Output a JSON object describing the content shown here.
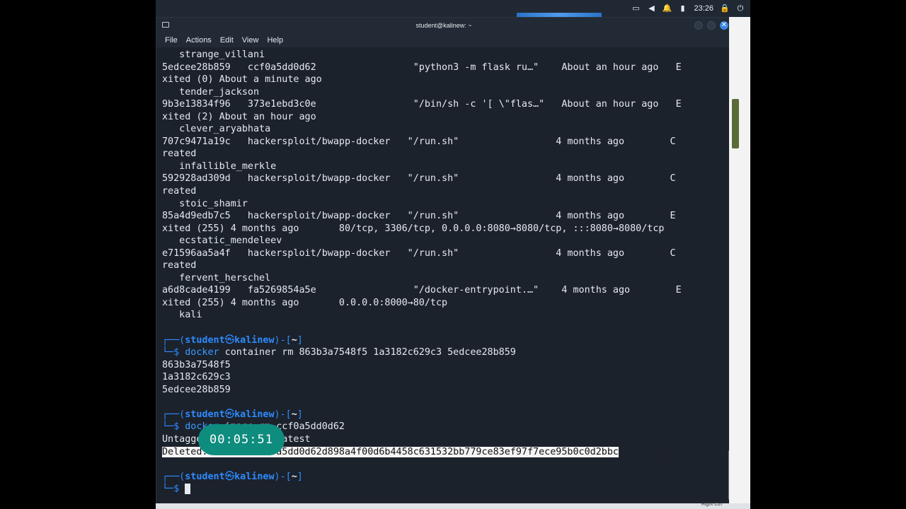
{
  "topbar": {
    "clock": "23:26",
    "icons": [
      "window-icon",
      "volume-icon",
      "bell-icon",
      "battery-icon",
      "lock-icon",
      "power-icon"
    ]
  },
  "window": {
    "title": "student@kalinew: ~",
    "menu": [
      "File",
      "Actions",
      "Edit",
      "View",
      "Help"
    ]
  },
  "terminal": {
    "output_lines": [
      "   strange_villani",
      "5edcee28b859   ccf0a5dd0d62                 \"python3 -m flask ru…\"    About an hour ago   E",
      "xited (0) About a minute ago",
      "   tender_jackson",
      "9b3e13834f96   373e1ebd3c0e                 \"/bin/sh -c '[ \\\"flas…\"   About an hour ago   E",
      "xited (2) About an hour ago",
      "   clever_aryabhata",
      "707c9471a19c   hackersploit/bwapp-docker   \"/run.sh\"                 4 months ago        C",
      "reated",
      "   infallible_merkle",
      "592928ad309d   hackersploit/bwapp-docker   \"/run.sh\"                 4 months ago        C",
      "reated",
      "   stoic_shamir",
      "85a4d9edb7c5   hackersploit/bwapp-docker   \"/run.sh\"                 4 months ago        E",
      "xited (255) 4 months ago       80/tcp, 3306/tcp, 0.0.0.0:8080→8080/tcp, :::8080→8080/tcp",
      "   ecstatic_mendeleev",
      "e71596aa5a4f   hackersploit/bwapp-docker   \"/run.sh\"                 4 months ago        C",
      "reated",
      "   fervent_herschel",
      "a6d8cade4199   fa5269854a5e                 \"/docker-entrypoint.…\"    4 months ago        E",
      "xited (255) 4 months ago       0.0.0.0:8000→80/tcp",
      "   kali",
      ""
    ],
    "prompt_user": "student",
    "prompt_host": "kalinew",
    "prompt_path": "~",
    "cmd1_bin": "docker",
    "cmd1_args": " container rm 863b3a7548f5 1a3182c629c3 5edcee28b859",
    "cmd1_output": [
      "863b3a7548f5",
      "1a3182c629c3",
      "5edcee28b859",
      ""
    ],
    "cmd2_bin": "docker",
    "cmd2_args": " image rm ccf0a5dd0d62",
    "cmd2_out1": "Untagged: flask-app:latest",
    "cmd2_out2": "Deleted: sha256:ccf0a5dd0d62d898a4f00d6b4458c631532bb779ce83ef97f7ece95b0c0d2bbc",
    "final_prompt_symbol": "$"
  },
  "timer": "00:05:51",
  "taskbar": {
    "right_label": "Right Ctrl"
  }
}
